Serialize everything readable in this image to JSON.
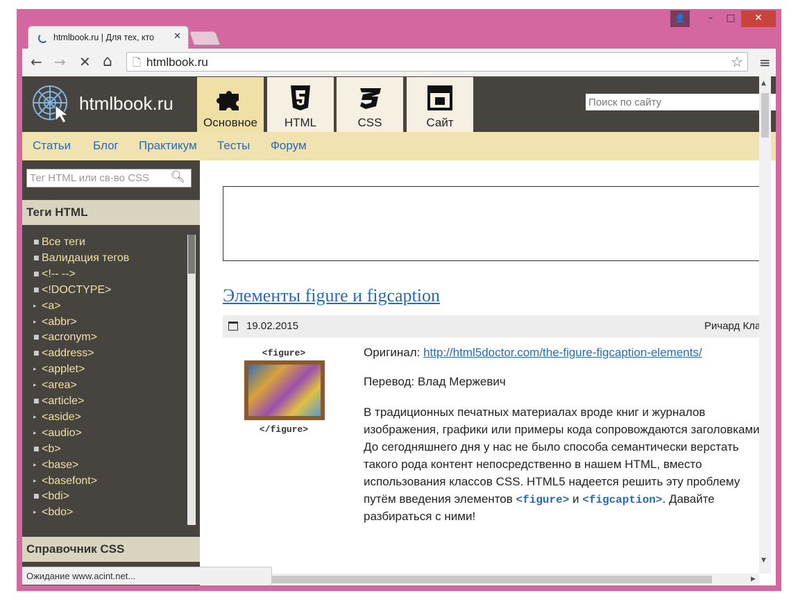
{
  "window": {
    "controls": {
      "user": "👤",
      "minimize": "–",
      "maximize": "□",
      "close": "✕"
    }
  },
  "tab": {
    "title": "htmlbook.ru | Для тех, кто",
    "close": "✕"
  },
  "toolbar": {
    "back": "←",
    "forward": "→",
    "stop": "✕",
    "home": "⌂",
    "url": "htmlbook.ru",
    "star": "☆",
    "menu": "≡"
  },
  "site": {
    "logo_text": "htmlbook.ru",
    "main_tabs": [
      {
        "label": "Основное",
        "icon": "puzzle-icon",
        "active": true
      },
      {
        "label": "HTML",
        "icon": "html5-icon",
        "active": false
      },
      {
        "label": "CSS",
        "icon": "css3-icon",
        "active": false
      },
      {
        "label": "Сайт",
        "icon": "layout-icon",
        "active": false
      }
    ],
    "search_placeholder": "Поиск по сайту",
    "nav": [
      "Статьи",
      "Блог",
      "Практикум",
      "Тесты",
      "Форум"
    ]
  },
  "sidebar": {
    "search_placeholder": "Тег HTML или св-во CSS",
    "tags_heading": "Теги HTML",
    "tags": [
      {
        "label": "Все теги",
        "marker": "doc"
      },
      {
        "label": "Валидация тегов",
        "marker": "doc"
      },
      {
        "label": "<!-- -->",
        "marker": "doc"
      },
      {
        "label": "<!DOCTYPE>",
        "marker": "doc"
      },
      {
        "label": "<a>",
        "marker": "arrow"
      },
      {
        "label": "<abbr>",
        "marker": "arrow"
      },
      {
        "label": "<acronym>",
        "marker": "doc"
      },
      {
        "label": "<address>",
        "marker": "doc"
      },
      {
        "label": "<applet>",
        "marker": "arrow"
      },
      {
        "label": "<area>",
        "marker": "arrow"
      },
      {
        "label": "<article>",
        "marker": "doc"
      },
      {
        "label": "<aside>",
        "marker": "arrow"
      },
      {
        "label": "<audio>",
        "marker": "arrow"
      },
      {
        "label": "<b>",
        "marker": "doc"
      },
      {
        "label": "<base>",
        "marker": "arrow"
      },
      {
        "label": "<basefont>",
        "marker": "arrow"
      },
      {
        "label": "<bdi>",
        "marker": "doc"
      },
      {
        "label": "<bdo>",
        "marker": "arrow"
      }
    ],
    "css_heading": "Справочник CSS"
  },
  "article": {
    "title": "Элементы figure и figcaption",
    "date": "19.02.2015",
    "author": "Ричард Кларк",
    "figure_caption_open": "<figure>",
    "figure_caption_close": "</figure>",
    "original_label": "Оригинал: ",
    "original_link": "http://html5doctor.com/the-figure-figcaption-elements/",
    "translation": "Перевод: Влад Мержевич",
    "body_lines": [
      "В традиционных печатных материалах вроде книг и журналов",
      "изображения, графики или примеры кода сопровождаются заголовками.",
      "До сегодняшнего дня у нас не было способа семантически верстать",
      "такого рода контент непосредственно в нашем HTML, вместо",
      "использования классов CSS. HTML5 надеется решить эту проблему"
    ],
    "body_line6_start": "путём введения элементов ",
    "code_figure": "<figure>",
    "body_line6_mid": " и ",
    "code_figcaption": "<figcaption>",
    "body_line6_end": ". Давайте",
    "body_line7": "разбираться с ними!"
  },
  "status_text": "Ожидание www.acint.net..."
}
